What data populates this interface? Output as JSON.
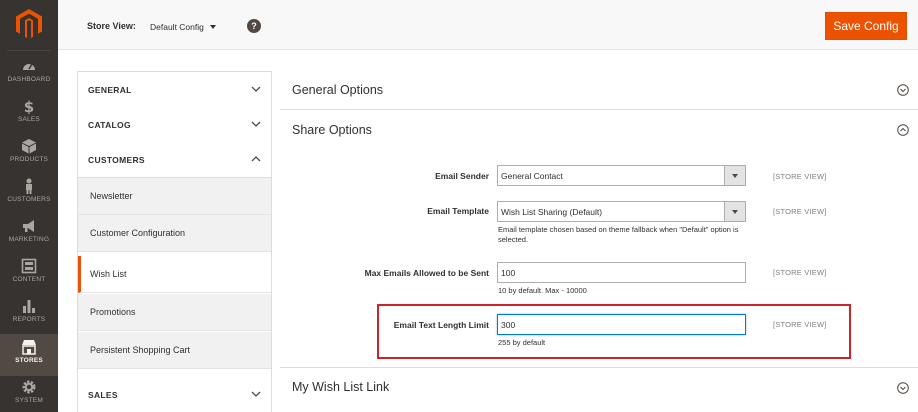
{
  "nav": {
    "items": [
      {
        "label": "DASHBOARD",
        "icon": "dashboard-icon"
      },
      {
        "label": "SALES",
        "icon": "dollar-icon"
      },
      {
        "label": "PRODUCTS",
        "icon": "box-icon"
      },
      {
        "label": "CUSTOMERS",
        "icon": "person-icon"
      },
      {
        "label": "MARKETING",
        "icon": "megaphone-icon"
      },
      {
        "label": "CONTENT",
        "icon": "content-icon"
      },
      {
        "label": "REPORTS",
        "icon": "bar-chart-icon"
      },
      {
        "label": "STORES",
        "icon": "store-icon"
      },
      {
        "label": "SYSTEM",
        "icon": "gear-icon"
      }
    ],
    "active_color": "#514943"
  },
  "header": {
    "store_view_label": "Store View:",
    "store_view_value": "Default Config",
    "help_glyph": "?",
    "save_label": "Save Config",
    "accent": "#eb5202"
  },
  "tabs": {
    "general": "GENERAL",
    "catalog": "CATALOG",
    "customers": "CUSTOMERS",
    "items": [
      {
        "label": "Newsletter"
      },
      {
        "label": "Customer Configuration"
      },
      {
        "label": "Wish List"
      },
      {
        "label": "Promotions"
      },
      {
        "label": "Persistent Shopping Cart"
      }
    ],
    "sales": "SALES"
  },
  "main": {
    "general_options": "General Options",
    "share_options": "Share Options",
    "wishlist_link": "My Wish List Link",
    "scope": "[STORE VIEW]",
    "fields": {
      "email_sender": {
        "label": "Email Sender",
        "value": "General Contact"
      },
      "email_template": {
        "label": "Email Template",
        "value": "Wish List Sharing (Default)",
        "note": "Email template chosen based on theme fallback when \"Default\" option is selected."
      },
      "max_emails": {
        "label": "Max Emails Allowed to be Sent",
        "value": "100",
        "note": "10 by default. Max - 10000"
      },
      "text_length": {
        "label": "Email Text Length Limit",
        "value": "300",
        "note": "255 by default"
      }
    },
    "highlight_color": "#c8252c"
  }
}
